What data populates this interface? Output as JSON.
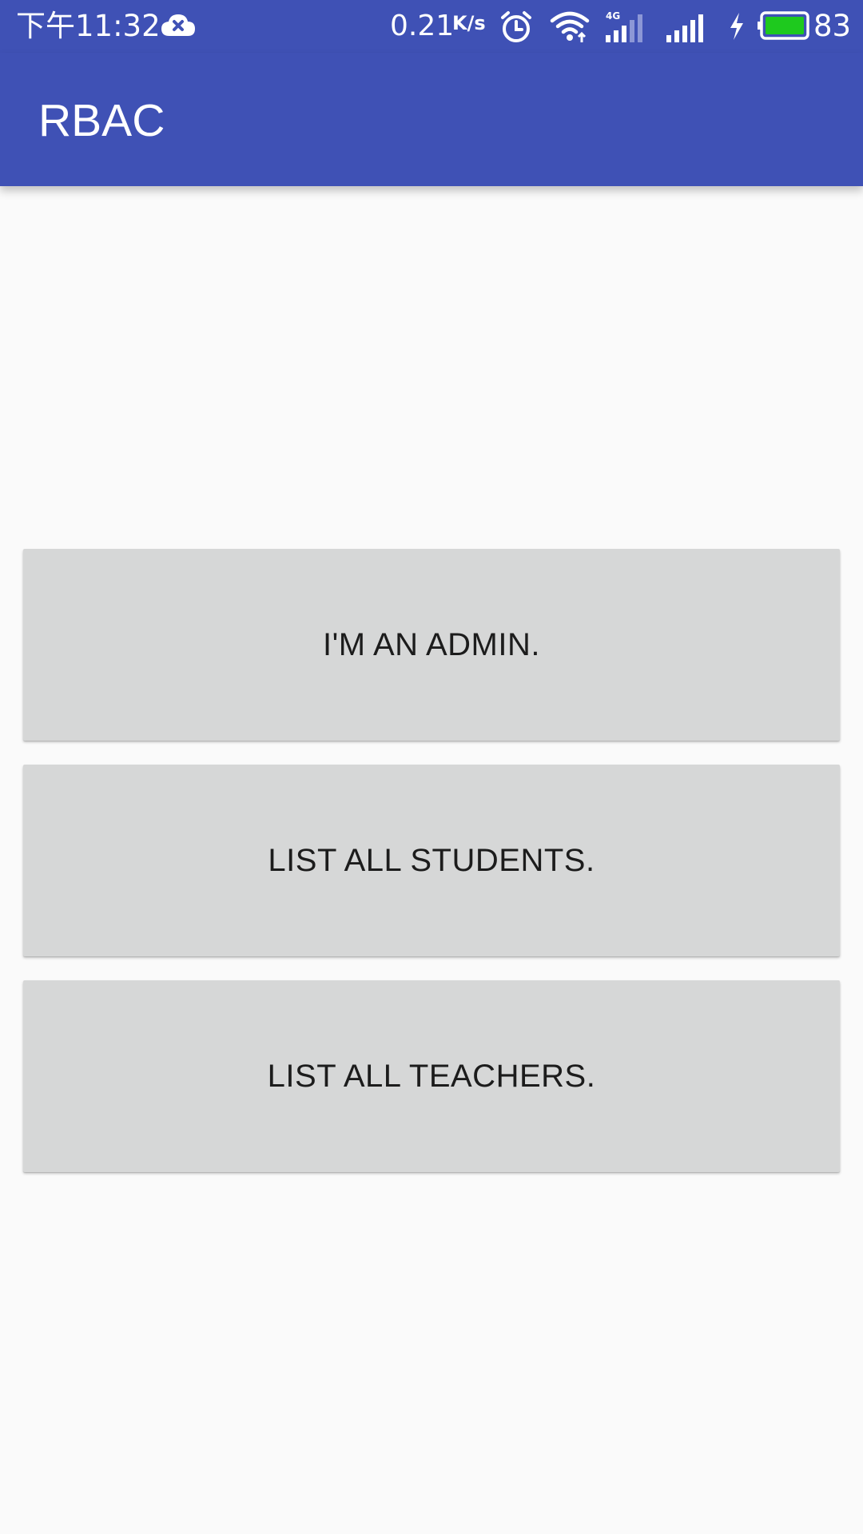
{
  "status_bar": {
    "time": "下午11:32",
    "net_speed_value": "0.21",
    "net_speed_unit": "K/s",
    "network_type": "4G",
    "battery_percent": "83",
    "battery_level": 0.83,
    "battery_color": "#1ec91e",
    "icons": [
      "cloud-sync-error-icon",
      "alarm-icon",
      "wifi-icon",
      "4g-signal-icon",
      "cell-signal-icon",
      "charging-icon",
      "battery-icon"
    ]
  },
  "app_bar": {
    "title": "RBAC",
    "color": "#3f51b5"
  },
  "buttons": [
    {
      "label": "I'M AN ADMIN."
    },
    {
      "label": "LIST ALL STUDENTS."
    },
    {
      "label": "LIST ALL TEACHERS."
    }
  ]
}
